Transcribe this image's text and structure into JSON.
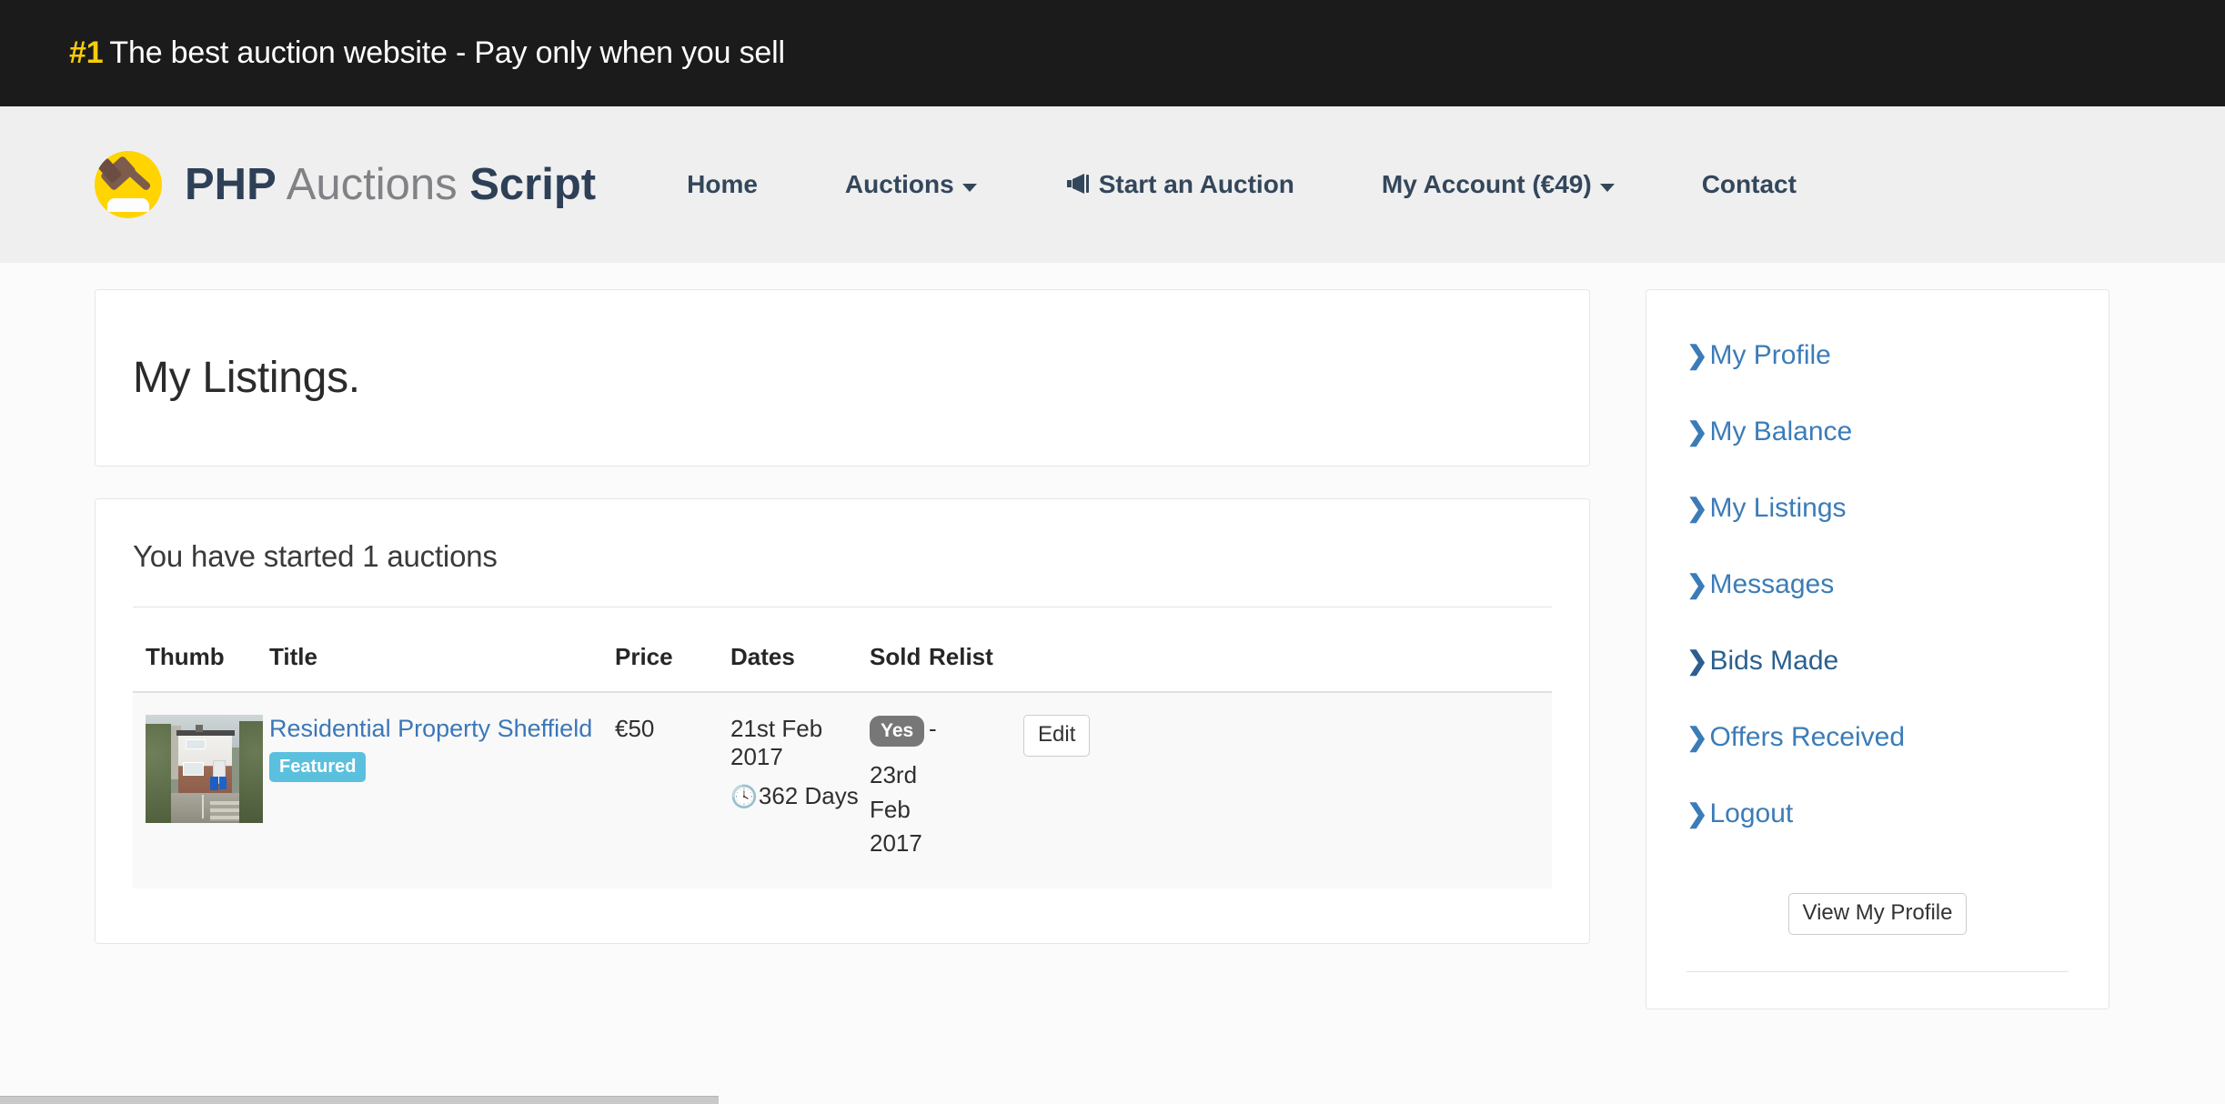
{
  "topbar": {
    "badge": "#1",
    "message": "The best auction website - Pay only when you sell"
  },
  "brand": {
    "part1": "PHP",
    "part2": "Auctions",
    "part3": "Script",
    "logo_icon": "gavel-icon"
  },
  "nav": {
    "home": "Home",
    "auctions": "Auctions",
    "start_auction": "Start an Auction",
    "start_auction_icon": "megaphone-icon",
    "my_account": "My Account (€49)",
    "contact": "Contact"
  },
  "main": {
    "page_title": "My Listings.",
    "listings_heading": "You have started 1 auctions",
    "table": {
      "headers": [
        "Thumb",
        "Title",
        "Price",
        "Dates",
        "Sold",
        "Relist",
        ""
      ],
      "rows": [
        {
          "thumb_alt": "property-photo",
          "title": "Residential Property Sheffield",
          "badge": "Featured",
          "price": "€50",
          "date_start": "21st Feb 2017",
          "duration": "362 Days",
          "duration_icon": "clock-icon",
          "sold_badge": "Yes",
          "sold_date": "23rd Feb 2017",
          "relist": "-",
          "action": "Edit"
        }
      ]
    }
  },
  "sidebar": {
    "links": [
      {
        "label": "My Profile",
        "active": false
      },
      {
        "label": "My Balance",
        "active": false
      },
      {
        "label": "My Listings",
        "active": false
      },
      {
        "label": "Messages",
        "active": false
      },
      {
        "label": "Bids Made",
        "active": true
      },
      {
        "label": "Offers Received",
        "active": false
      },
      {
        "label": "Logout",
        "active": false
      }
    ],
    "view_profile_button": "View My Profile"
  },
  "colors": {
    "topbar_bg": "#1b1b1b",
    "accent_yellow": "#f7cd0a",
    "brand_navy": "#2e4057",
    "link_blue": "#3b77b8",
    "badge_featured": "#5bc0de",
    "badge_sold": "#777777"
  }
}
